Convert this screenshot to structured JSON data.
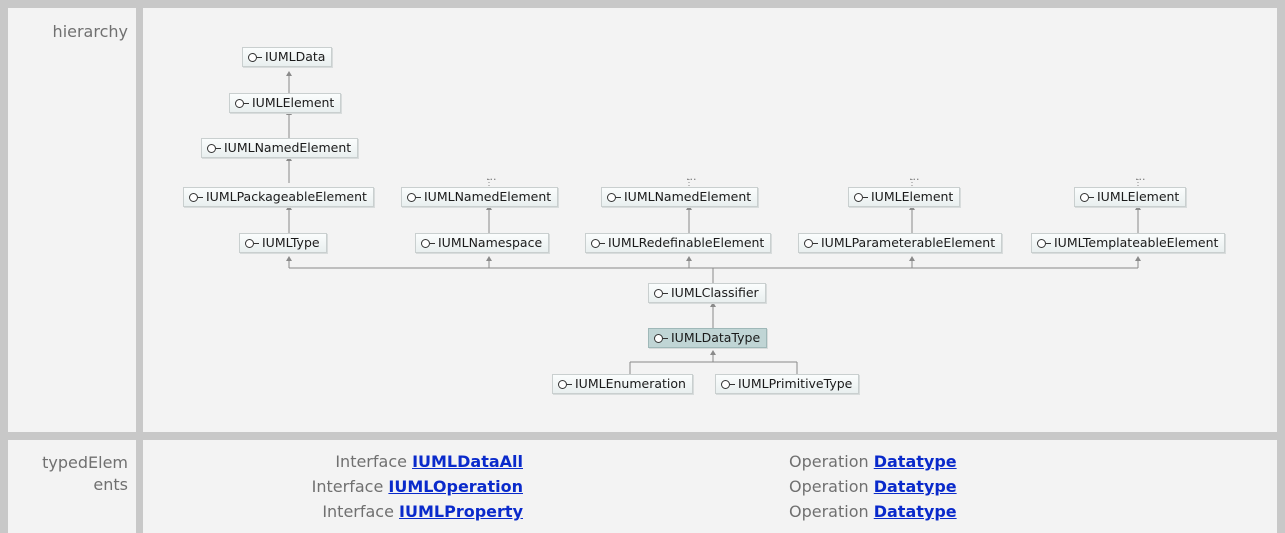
{
  "rows": {
    "hierarchy_label": "hierarchy",
    "typed_label_line1": "typedElem",
    "typed_label_line2": "ents"
  },
  "diagram": {
    "nodes": {
      "data": "IUMLData",
      "element_1": "IUMLElement",
      "named_element_1": "IUMLNamedElement",
      "packageable": "IUMLPackageableElement",
      "named_element_2": "IUMLNamedElement",
      "named_element_3": "IUMLNamedElement",
      "element_2": "IUMLElement",
      "element_3": "IUMLElement",
      "type": "IUMLType",
      "namespace": "IUMLNamespace",
      "redefinable": "IUMLRedefinableElement",
      "parameterable": "IUMLParameterableElement",
      "templateable": "IUMLTemplateableElement",
      "classifier": "IUMLClassifier",
      "datatype": "IUMLDataType",
      "enumeration": "IUMLEnumeration",
      "primitive": "IUMLPrimitiveType"
    },
    "ellipsis": "..."
  },
  "typed_elements": [
    {
      "kind": "Interface",
      "name": "IUMLDataAll",
      "op_kind": "Operation",
      "op_name": "Datatype"
    },
    {
      "kind": "Interface",
      "name": "IUMLOperation",
      "op_kind": "Operation",
      "op_name": "Datatype"
    },
    {
      "kind": "Interface",
      "name": "IUMLProperty",
      "op_kind": "Operation",
      "op_name": "Datatype"
    }
  ],
  "colors": {
    "link": "#0a2acb",
    "label": "#707070",
    "selected_node": "#c0d5d5",
    "cell_bg": "#f3f3f3",
    "border": "#c8c8c8"
  }
}
